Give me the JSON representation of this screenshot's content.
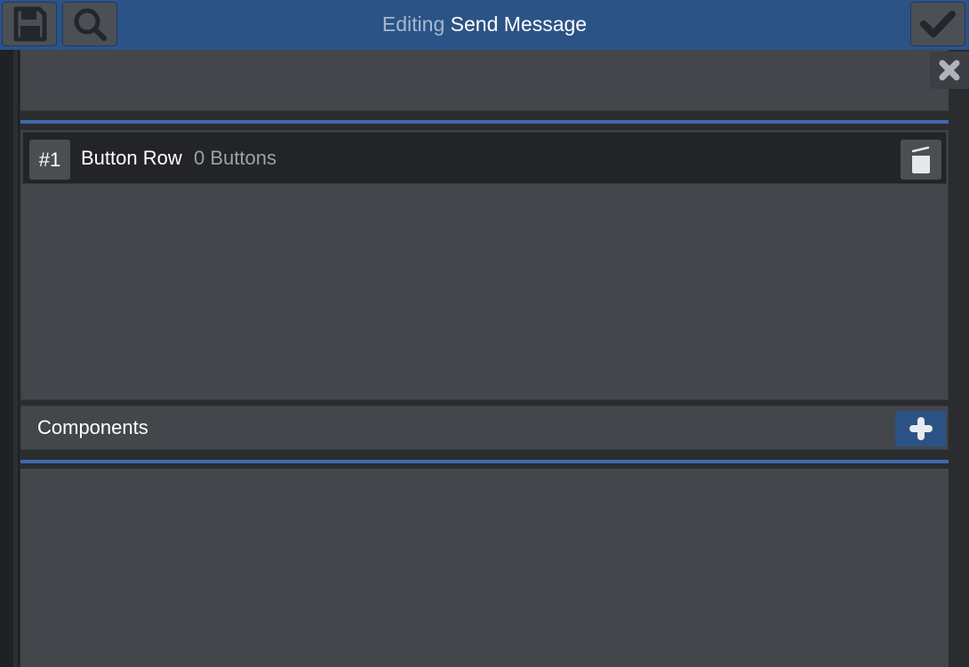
{
  "header": {
    "title_prefix": "Editing",
    "title_name": "Send Message",
    "save_icon": "floppy-disk-icon",
    "search_icon": "magnifier-icon",
    "confirm_icon": "checkmark-icon"
  },
  "close_icon": "x-icon",
  "rows": [
    {
      "index": "#1",
      "title": "Button Row",
      "subtitle": "0 Buttons",
      "delete_icon": "trash-can-icon"
    }
  ],
  "components": {
    "label": "Components",
    "add_icon": "plus-icon"
  },
  "colors": {
    "header": "#2c5386",
    "accent_divider": "#3e69ad",
    "panel": "#43464b",
    "row_bg": "#232427"
  }
}
